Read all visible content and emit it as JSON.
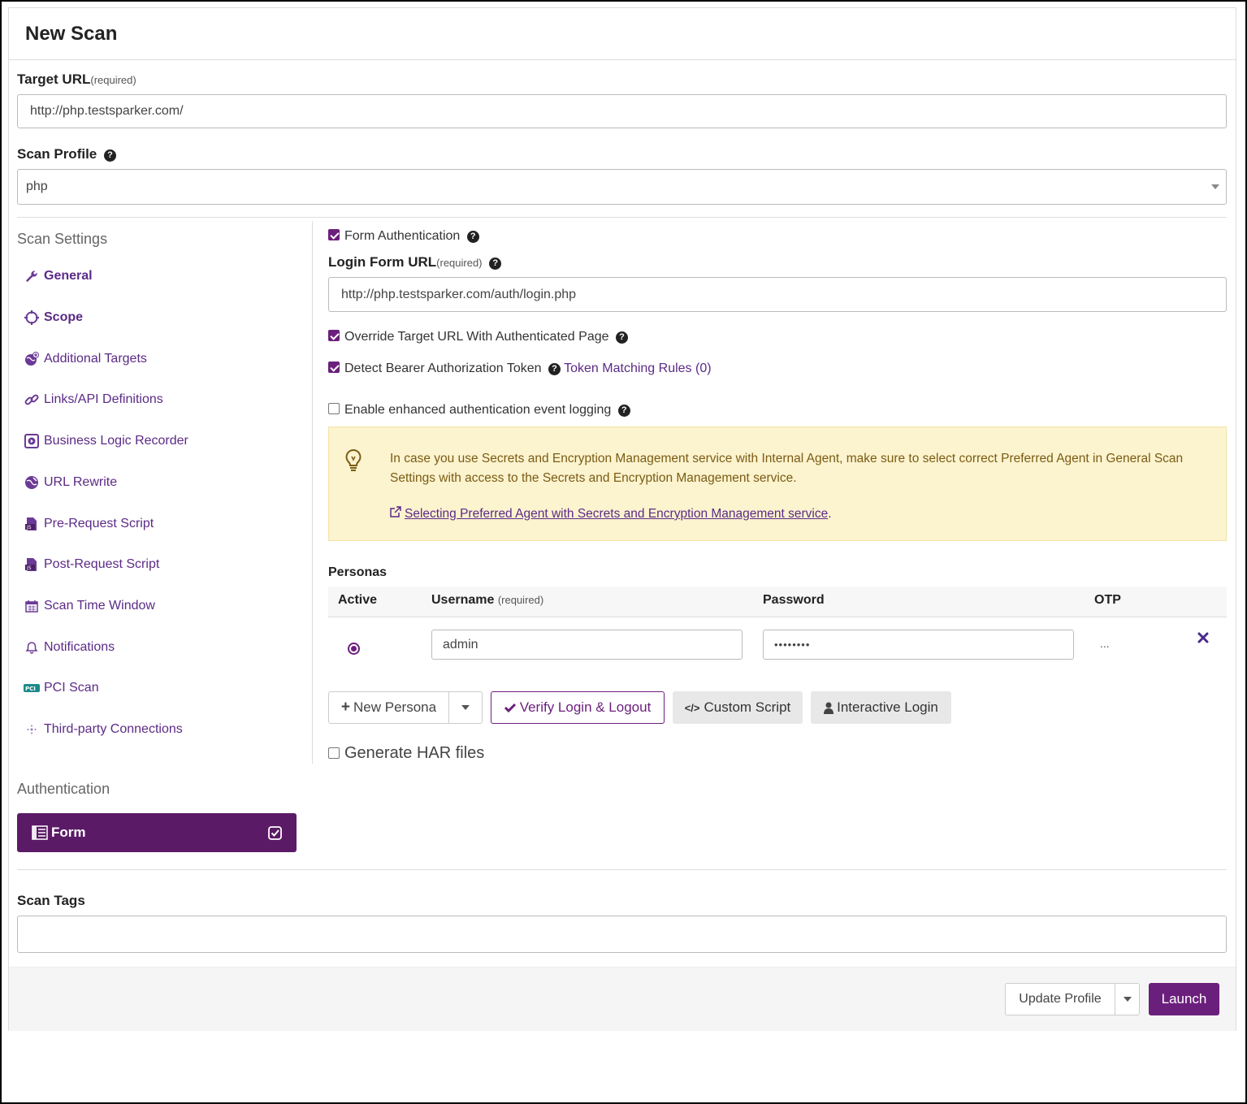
{
  "header": {
    "title": "New Scan"
  },
  "target_url": {
    "label": "Target URL",
    "required": "(required)",
    "value": "http://php.testsparker.com/"
  },
  "scan_profile": {
    "label": "Scan Profile",
    "value": "php"
  },
  "scan_settings": {
    "title": "Scan Settings",
    "items": [
      {
        "label": "General",
        "icon": "wrench-icon"
      },
      {
        "label": "Scope",
        "icon": "target-icon"
      },
      {
        "label": "Additional Targets",
        "icon": "globe-plus-icon"
      },
      {
        "label": "Links/API Definitions",
        "icon": "link-icon"
      },
      {
        "label": "Business Logic Recorder",
        "icon": "play-square-icon"
      },
      {
        "label": "URL Rewrite",
        "icon": "globe-rewrite-icon"
      },
      {
        "label": "Pre-Request Script",
        "icon": "js-file-icon"
      },
      {
        "label": "Post-Request Script",
        "icon": "js-file-icon"
      },
      {
        "label": "Scan Time Window",
        "icon": "calendar-icon"
      },
      {
        "label": "Notifications",
        "icon": "bell-icon"
      },
      {
        "label": "PCI Scan",
        "icon": "pci-icon"
      },
      {
        "label": "Third-party Connections",
        "icon": "connections-icon"
      }
    ]
  },
  "authentication": {
    "title": "Authentication",
    "selected": "Form"
  },
  "form_auth": {
    "enabled_label": "Form Authentication",
    "login_url_label": "Login Form URL",
    "login_url_required": "(required)",
    "login_url_value": "http://php.testsparker.com/auth/login.php",
    "override_label": "Override Target URL With Authenticated Page",
    "bearer_label": "Detect Bearer Authorization Token",
    "token_rules_link": "Token Matching Rules (0)",
    "enhanced_logging_label": "Enable enhanced authentication event logging",
    "alert_text": "In case you use Secrets and Encryption Management service with Internal Agent, make sure to select correct Preferred Agent in General Scan Settings with access to the Secrets and Encryption Management service.",
    "alert_link": "Selecting Preferred Agent with Secrets and Encryption Management service",
    "alert_link_suffix": "."
  },
  "personas": {
    "title": "Personas",
    "columns": {
      "active": "Active",
      "username": "Username",
      "username_required": "(required)",
      "password": "Password",
      "otp": "OTP"
    },
    "rows": [
      {
        "username": "admin",
        "password": "••••••••",
        "otp": "..."
      }
    ]
  },
  "buttons": {
    "new_persona": "New Persona",
    "verify": "Verify Login & Logout",
    "custom_script": "Custom Script",
    "interactive_login": "Interactive Login"
  },
  "har": {
    "label": "Generate HAR files"
  },
  "scan_tags": {
    "label": "Scan Tags",
    "value": ""
  },
  "footer": {
    "update_profile": "Update Profile",
    "launch": "Launch"
  },
  "colors": {
    "accent": "#5b1a66",
    "link": "#5b2a86",
    "alert_bg": "#fcf3cf"
  }
}
